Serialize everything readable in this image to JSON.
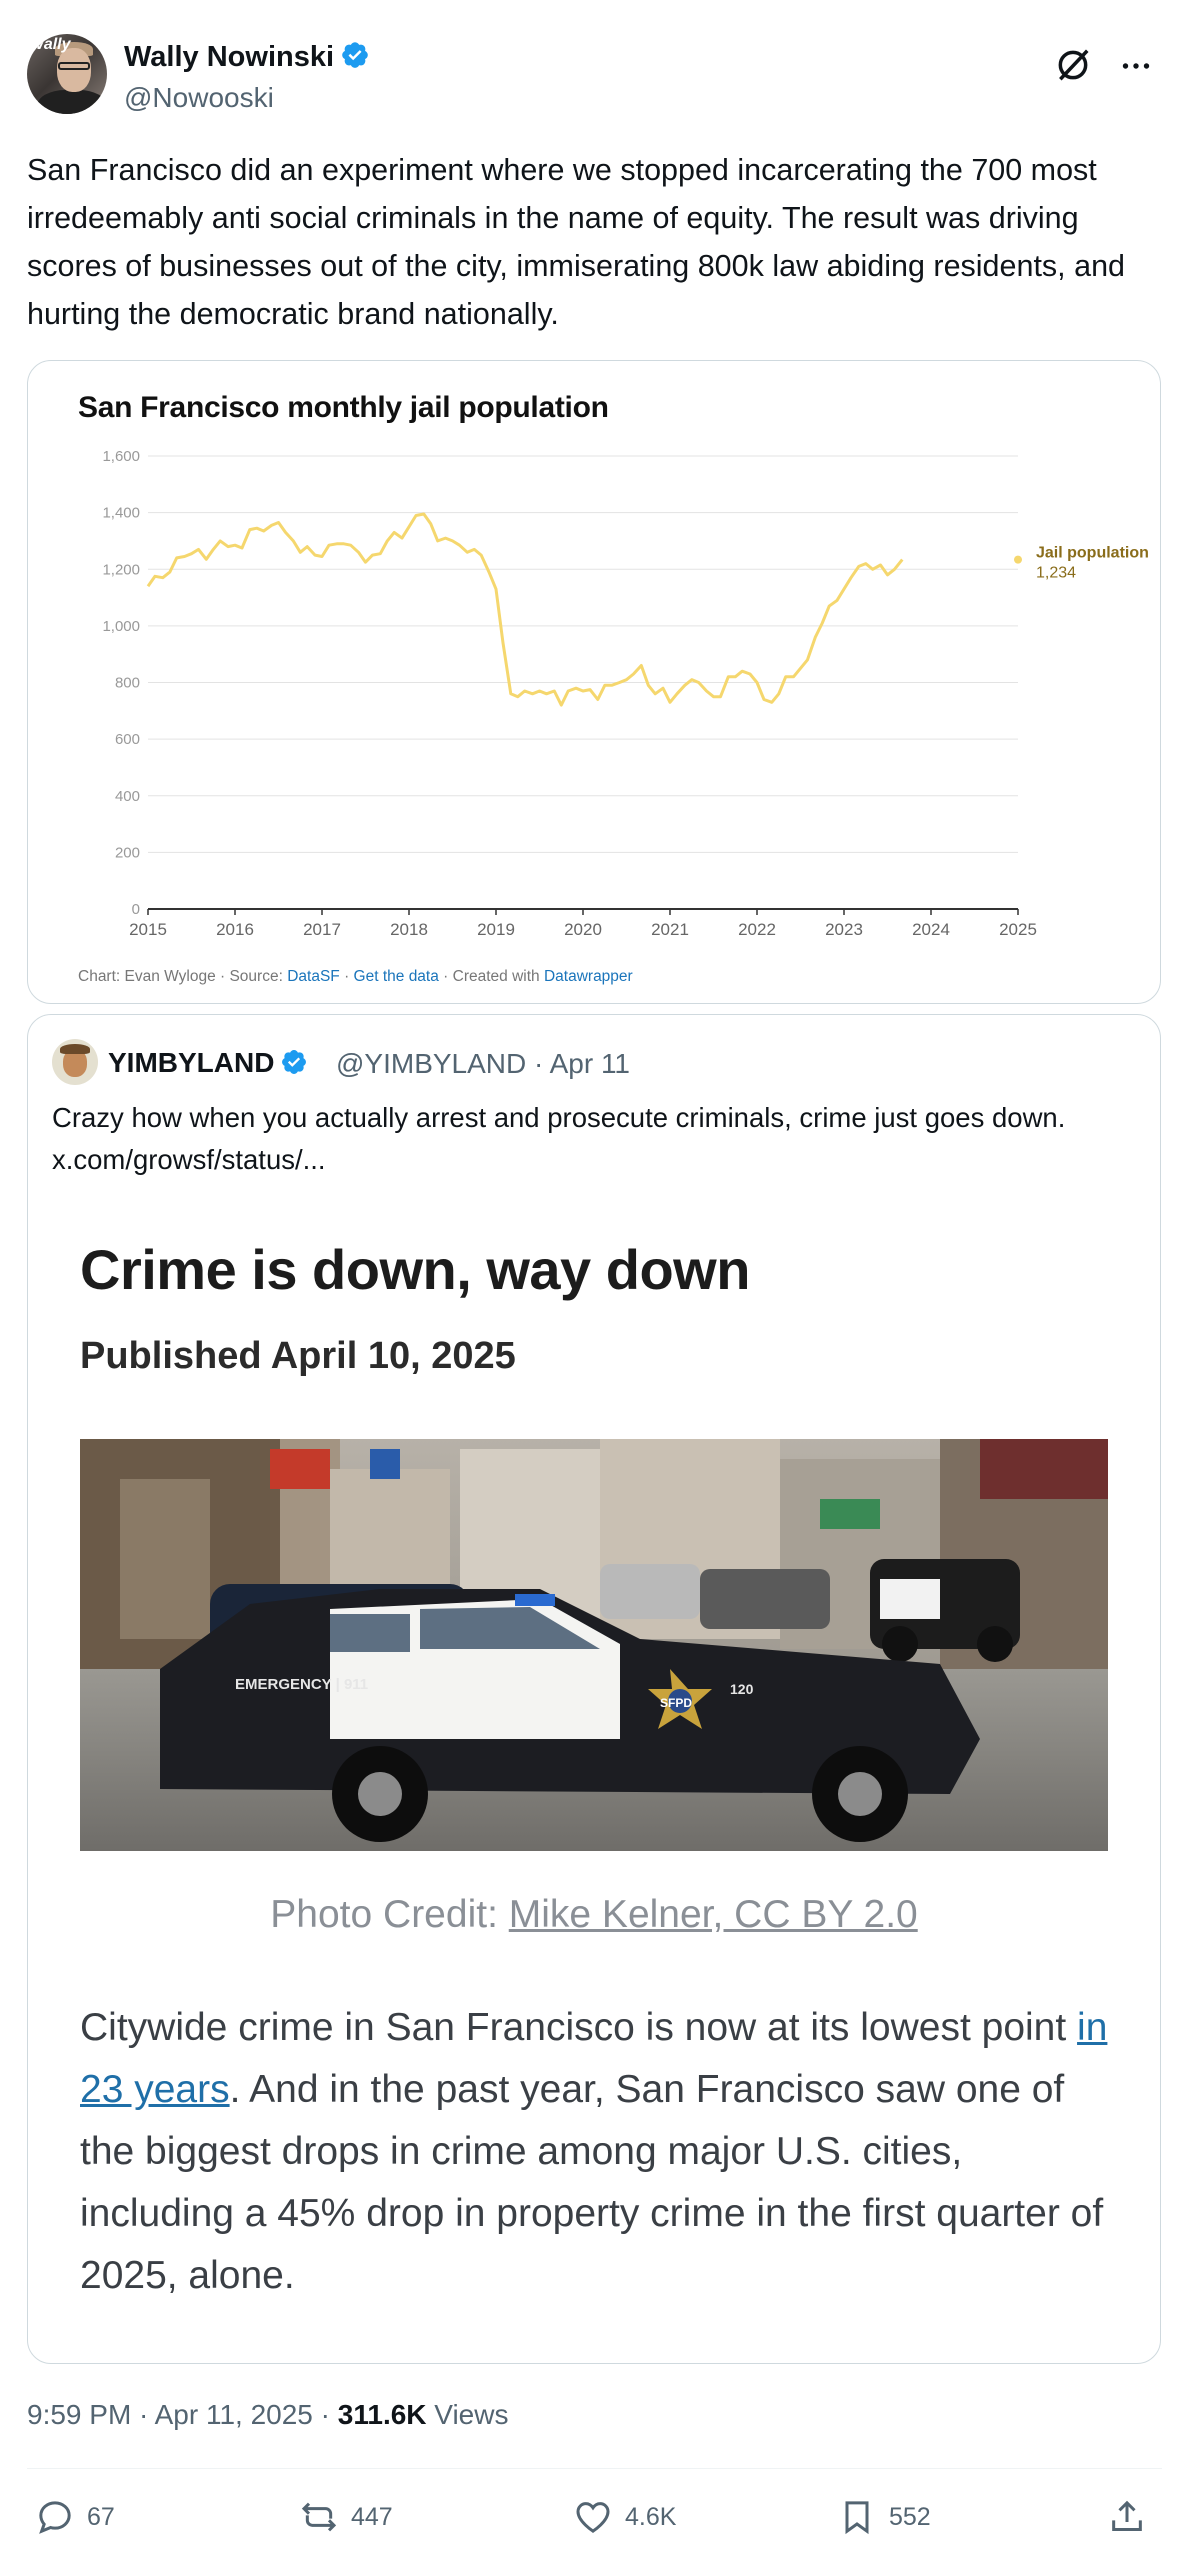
{
  "author": {
    "name": "Wally Nowinski",
    "handle": "@Nowooski",
    "avatar_text": "Wally"
  },
  "tweet": {
    "text": "San Francisco did an experiment where we stopped incarcerating the 700 most irredeemably anti social criminals in the name of equity. The result was driving scores of businesses out of the city, immiserating 800k law abiding residents, and hurting the democratic brand nationally."
  },
  "chart_data": {
    "type": "line",
    "title": "San Francisco monthly jail population",
    "x": [
      2015.0,
      2015.08,
      2015.17,
      2015.25,
      2015.33,
      2015.42,
      2015.5,
      2015.58,
      2015.67,
      2015.75,
      2015.83,
      2015.92,
      2016.0,
      2016.08,
      2016.17,
      2016.25,
      2016.33,
      2016.42,
      2016.5,
      2016.58,
      2016.67,
      2016.75,
      2016.83,
      2016.92,
      2017.0,
      2017.08,
      2017.17,
      2017.25,
      2017.33,
      2017.42,
      2017.5,
      2017.58,
      2017.67,
      2017.75,
      2017.83,
      2017.92,
      2018.0,
      2018.08,
      2018.17,
      2018.25,
      2018.33,
      2018.42,
      2018.5,
      2018.58,
      2018.67,
      2018.75,
      2018.83,
      2018.92,
      2019.0,
      2019.08,
      2019.17,
      2019.25,
      2019.33,
      2019.42,
      2019.5,
      2019.58,
      2019.67,
      2019.75,
      2019.83,
      2019.92,
      2020.0,
      2020.08,
      2020.17,
      2020.25,
      2020.33,
      2020.42,
      2020.5,
      2020.58,
      2020.67,
      2020.75,
      2020.83,
      2020.92,
      2021.0,
      2021.08,
      2021.17,
      2021.25,
      2021.33,
      2021.42,
      2021.5,
      2021.58,
      2021.67,
      2021.75,
      2021.83,
      2021.92,
      2022.0,
      2022.08,
      2022.17,
      2022.25,
      2022.33,
      2022.42,
      2022.5,
      2022.58,
      2022.67,
      2022.75,
      2022.83,
      2022.92,
      2023.0,
      2023.08,
      2023.17,
      2023.25,
      2023.33,
      2023.42,
      2023.5,
      2023.58,
      2023.67,
      2023.75,
      2023.83,
      2023.92,
      2024.0,
      2024.08,
      2024.17,
      2024.25,
      2024.33,
      2024.42,
      2024.5,
      2024.58,
      2024.67,
      2024.75,
      2024.83,
      2024.92,
      2025.0
    ],
    "series": [
      {
        "name": "Jail population",
        "values": [
          1140,
          1175,
          1170,
          1190,
          1240,
          1245,
          1255,
          1270,
          1235,
          1270,
          1300,
          1280,
          1285,
          1275,
          1340,
          1345,
          1335,
          1355,
          1365,
          1330,
          1300,
          1260,
          1280,
          1250,
          1245,
          1285,
          1290,
          1290,
          1285,
          1260,
          1225,
          1250,
          1255,
          1300,
          1330,
          1310,
          1350,
          1390,
          1395,
          1360,
          1300,
          1310,
          1300,
          1285,
          1260,
          1270,
          1250,
          1190,
          1130,
          940,
          760,
          750,
          770,
          760,
          770,
          760,
          770,
          720,
          770,
          780,
          770,
          775,
          740,
          790,
          790,
          800,
          810,
          830,
          860,
          790,
          760,
          780,
          730,
          760,
          790,
          810,
          800,
          770,
          750,
          750,
          820,
          820,
          840,
          830,
          800,
          740,
          730,
          760,
          820,
          820,
          850,
          880,
          960,
          1010,
          1070,
          1090,
          1130,
          1170,
          1210,
          1220,
          1200,
          1215,
          1180,
          1200,
          1234
        ]
      }
    ],
    "series_label": "Jail population",
    "last_value_label": "1,234",
    "xlim": [
      2015,
      2025
    ],
    "ylim": [
      0,
      1600
    ],
    "y_ticks": [
      0,
      200,
      400,
      600,
      800,
      1000,
      1200,
      1400,
      1600
    ],
    "y_tick_labels": [
      "0",
      "200",
      "400",
      "600",
      "800",
      "1,000",
      "1,200",
      "1,400",
      "1,600"
    ],
    "x_ticks": [
      2015,
      2016,
      2017,
      2018,
      2019,
      2020,
      2021,
      2022,
      2023,
      2024,
      2025
    ],
    "x_tick_labels": [
      "2015",
      "2016",
      "2017",
      "2018",
      "2019",
      "2020",
      "2021",
      "2022",
      "2023",
      "2024",
      "2025"
    ],
    "grid": true,
    "line_color": "#f5d76e",
    "label_color": "#8a6d1b"
  },
  "chart_footer": {
    "prefix": "Chart: Evan Wyloge · Source: ",
    "source_link": "DataSF",
    "sep1": " · ",
    "data_link": "Get the data",
    "sep2": " · Created with ",
    "tool_link": "Datawrapper"
  },
  "quote": {
    "name": "YIMBYLAND",
    "handle": "@YIMBYLAND",
    "date": "· Apr 11",
    "text": "Crazy how when you actually arrest and prosecute criminals, crime just goes down.  x.com/growsf/status/...",
    "headline": "Crime is down, way down",
    "published": "Published April 10, 2025",
    "photo_credit_prefix": "Photo Credit: ",
    "photo_credit_link": "Mike Kelner, CC BY 2.0",
    "photo_text_car": "EMERGENCY | 911",
    "photo_text_badge": "SFPD",
    "photo_text_num": "120",
    "body_part1": "Citywide crime in San Francisco is now at its lowest point ",
    "body_link": "in 23 years",
    "body_part2": ". And in the past year, San Francisco saw one of the biggest drops in crime among major U.S. cities, including a 45% drop in property crime in the first quarter of 2025, alone."
  },
  "meta": {
    "time": "9:59 PM · Apr 11, 2025 · ",
    "views_count": "311.6K",
    "views_label": " Views"
  },
  "actions": {
    "replies": "67",
    "reposts": "447",
    "likes": "4.6K",
    "bookmarks": "552"
  },
  "colors": {
    "verified": "#1d9bf0",
    "secondary_text": "#536471",
    "border": "#cfd9de"
  },
  "icons": [
    "verified-badge-icon",
    "grok-icon",
    "more-icon",
    "reply-icon",
    "repost-icon",
    "like-icon",
    "bookmark-icon",
    "share-icon"
  ]
}
